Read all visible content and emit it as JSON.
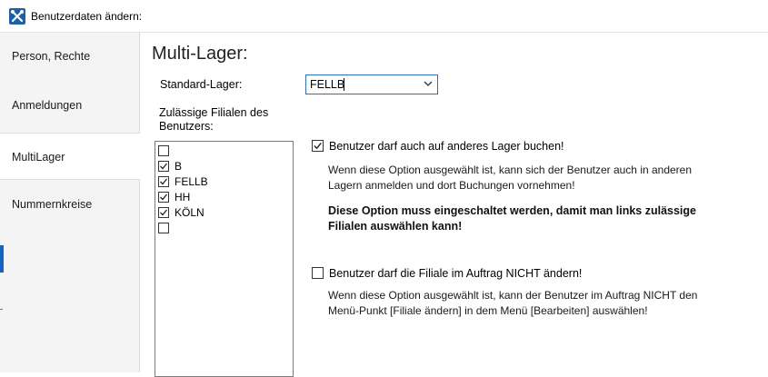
{
  "window": {
    "title": "Benutzerdaten ändern:"
  },
  "sidebar": {
    "items": [
      {
        "label": "Person, Rechte",
        "active": false
      },
      {
        "label": "Anmeldungen",
        "active": false
      },
      {
        "label": "MultiLager",
        "active": true
      },
      {
        "label": "Nummernkreise",
        "active": false
      }
    ]
  },
  "main": {
    "heading": "Multi-Lager:",
    "standard_lager_label": "Standard-Lager:",
    "standard_lager_value": "FELLB",
    "filialen_label": "Zulässige Filialen des Benutzers:",
    "filialen": [
      {
        "label": "",
        "checked": false
      },
      {
        "label": "B",
        "checked": true
      },
      {
        "label": "FELLB",
        "checked": true
      },
      {
        "label": "HH",
        "checked": true
      },
      {
        "label": "KÖLN",
        "checked": true
      },
      {
        "label": "",
        "checked": false
      }
    ],
    "option1": {
      "label": "Benutzer darf auch auf anderes Lager buchen!",
      "checked": true,
      "desc_line1": "Wenn diese Option ausgewählt ist, kann sich der Benutzer auch in anderen",
      "desc_line2": "Lagern anmelden und dort Buchungen vornehmen!",
      "bold_line1": "Diese Option muss eingeschaltet werden, damit man links zulässige",
      "bold_line2": "Filialen auswählen kann!"
    },
    "option2": {
      "label": "Benutzer darf die Filiale im Auftrag NICHT ändern!",
      "checked": false,
      "desc_line1": "Wenn diese Option ausgewählt ist, kann der Benutzer im Auftrag NICHT den",
      "desc_line2": "Menü-Punkt [Filiale ändern] in dem Menü [Bearbeiten] auswählen!"
    }
  },
  "colors": {
    "accent": "#2f6fb6",
    "sidebar_bg": "#f4f4f4",
    "active_bg": "#ffffff"
  }
}
